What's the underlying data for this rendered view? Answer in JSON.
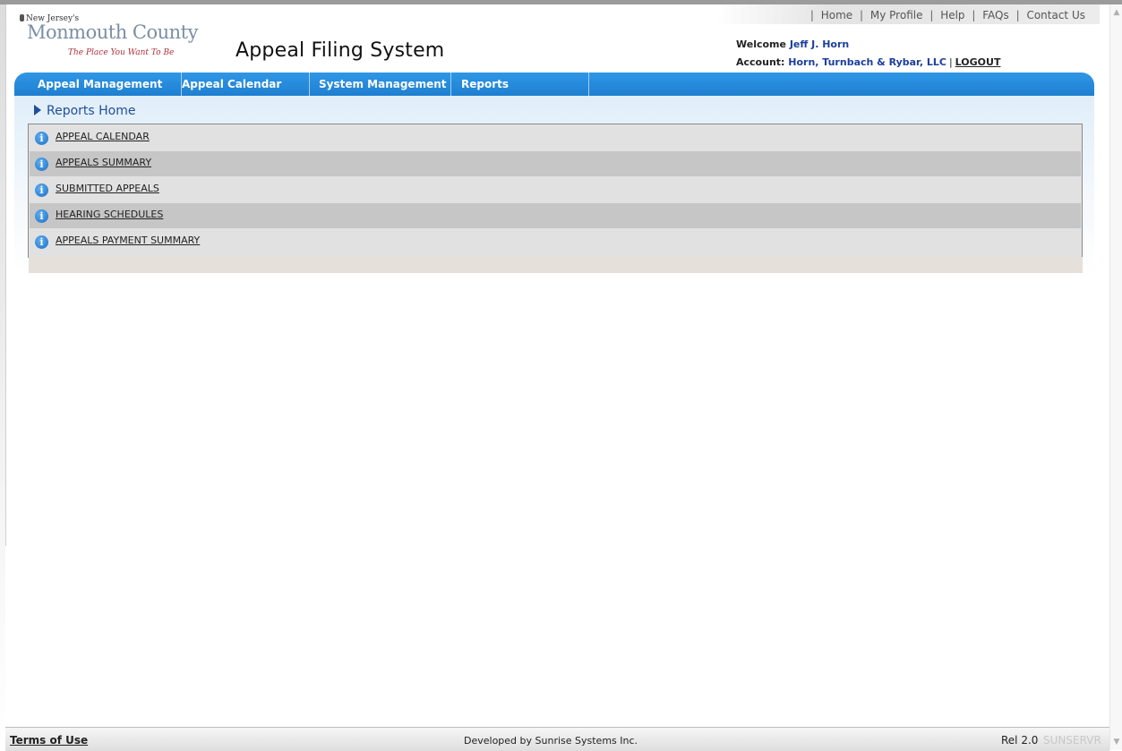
{
  "header": {
    "top_links": [
      "Home",
      "My Profile",
      "Help",
      "FAQs",
      "Contact Us"
    ],
    "logo": {
      "state": "New Jersey's",
      "county": "Monmouth County",
      "tagline": "The Place You Want To Be"
    },
    "app_title": "Appeal Filing System",
    "welcome_label": "Welcome",
    "user_name": "Jeff J. Horn",
    "account_label": "Account:",
    "account_name": "Horn, Turnbach & Rybar, LLC",
    "logout_label": "LOGOUT"
  },
  "nav": {
    "items": [
      "Appeal Management",
      "Appeal Calendar",
      "System Management",
      "Reports"
    ],
    "bar_color": "#1f7fd0"
  },
  "main": {
    "breadcrumb": "Reports Home",
    "reports": [
      "APPEAL CALENDAR",
      "APPEALS SUMMARY",
      "SUBMITTED APPEALS",
      "HEARING SCHEDULES",
      "APPEALS PAYMENT SUMMARY"
    ]
  },
  "footer": {
    "terms": "Terms of Use",
    "developer": "Developed by Sunrise Systems Inc.",
    "release": "Rel 2.0",
    "server": "SUNSERVR"
  }
}
